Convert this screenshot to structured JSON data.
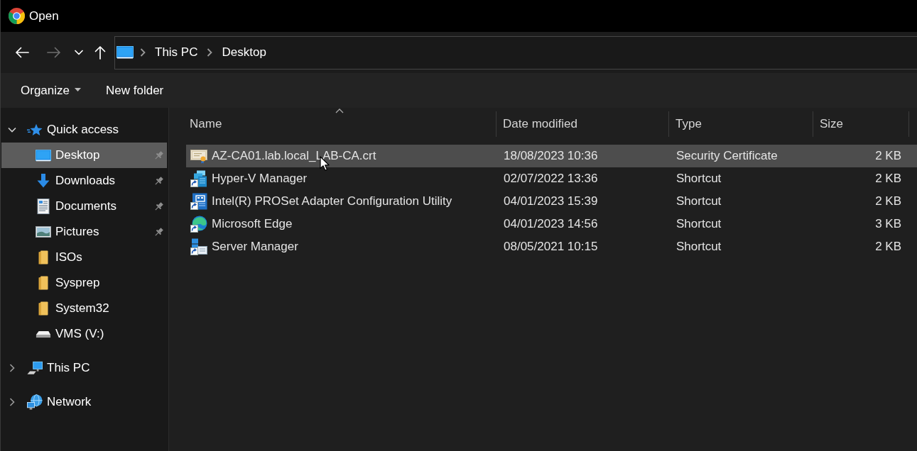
{
  "window": {
    "title": "Open"
  },
  "navigation": {
    "buttons": [
      {
        "kind": "back",
        "disabled": false
      },
      {
        "kind": "forward",
        "disabled": true
      },
      {
        "kind": "recent",
        "disabled": false
      },
      {
        "kind": "up",
        "disabled": false
      }
    ],
    "address": {
      "breadcrumbs": [
        "This PC",
        "Desktop"
      ]
    }
  },
  "toolbar": {
    "buttons": [
      {
        "kind": "menu",
        "label": "Organize"
      },
      {
        "kind": "button",
        "label": "New folder"
      }
    ]
  },
  "sidebar": {
    "items": [
      {
        "label": "Quick access",
        "kind": "star",
        "expanded": true,
        "selected": false,
        "children": [
          {
            "label": "Desktop",
            "kind": "desktop",
            "pinned": true,
            "selected": true
          },
          {
            "label": "Downloads",
            "kind": "download",
            "pinned": true,
            "selected": false
          },
          {
            "label": "Documents",
            "kind": "document",
            "pinned": true,
            "selected": false
          },
          {
            "label": "Pictures",
            "kind": "picture",
            "pinned": true,
            "selected": false
          },
          {
            "label": "ISOs",
            "kind": "folder",
            "pinned": false,
            "selected": false
          },
          {
            "label": "Sysprep",
            "kind": "folder",
            "pinned": false,
            "selected": false
          },
          {
            "label": "System32",
            "kind": "folder",
            "pinned": false,
            "selected": false
          },
          {
            "label": "VMS (V:)",
            "kind": "drive",
            "pinned": false,
            "selected": false
          }
        ]
      },
      {
        "label": "This PC",
        "kind": "computer",
        "expanded": false,
        "selected": false
      },
      {
        "label": "Network",
        "kind": "network",
        "expanded": false,
        "selected": false
      }
    ]
  },
  "table": {
    "columns": [
      {
        "label": "Name",
        "sorted": true
      },
      {
        "label": "Date modified",
        "sorted": false
      },
      {
        "label": "Type",
        "sorted": false
      },
      {
        "label": "Size",
        "sorted": false
      }
    ],
    "rows": [
      {
        "kind": "certificate",
        "name": "AZ-CA01.lab.local_LAB-CA.crt",
        "date_modified": "18/08/2023 10:36",
        "type": "Security Certificate",
        "size": "2 KB",
        "selected": true
      },
      {
        "kind": "hyperv",
        "name": "Hyper-V Manager",
        "date_modified": "02/07/2022 13:36",
        "type": "Shortcut",
        "size": "2 KB",
        "selected": false
      },
      {
        "kind": "adapter",
        "name": "Intel(R) PROSet Adapter Configuration Utility",
        "date_modified": "04/01/2023 15:39",
        "type": "Shortcut",
        "size": "2 KB",
        "selected": false
      },
      {
        "kind": "browser",
        "name": "Microsoft Edge",
        "date_modified": "04/01/2023 14:56",
        "type": "Shortcut",
        "size": "3 KB",
        "selected": false
      },
      {
        "kind": "server",
        "name": "Server Manager",
        "date_modified": "08/05/2021 10:15",
        "type": "Shortcut",
        "size": "2 KB",
        "selected": false
      }
    ]
  }
}
